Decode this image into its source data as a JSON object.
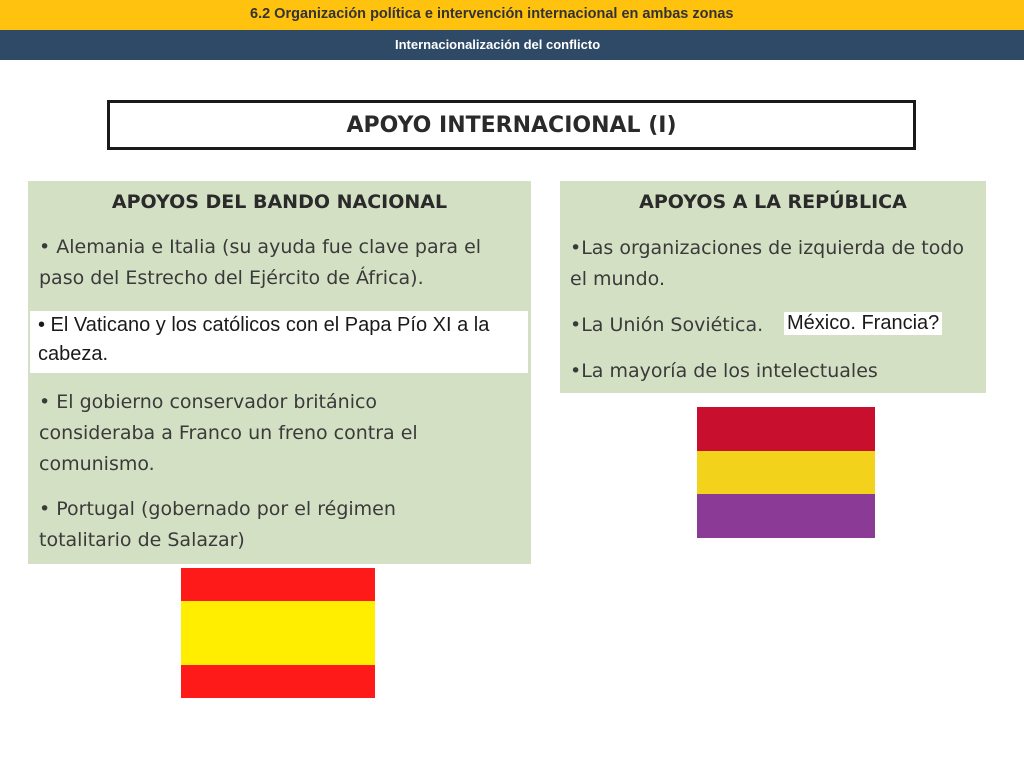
{
  "header": {
    "title": "6.2 Organización política e intervención internacional en ambas zonas",
    "subtitle": "Internacionalización del conflicto"
  },
  "slide": {
    "title": "APOYO INTERNACIONAL (I)"
  },
  "nacional": {
    "heading": "APOYOS DEL BANDO NACIONAL",
    "items": [
      "• Alemania e Italia (su ayuda fue clave para el paso del Estrecho del Ejército de África).",
      "• El Vaticano y los católicos con el Papa Pío XI a la cabeza.",
      "• El gobierno conservador británico consideraba a Franco un freno contra el comunismo.",
      "• Portugal (gobernado por el régimen totalitario de Salazar)"
    ]
  },
  "republica": {
    "heading": "APOYOS A LA REPÚBLICA",
    "items": [
      "•Las organizaciones de izquierda de todo el mundo.",
      "•La Unión Soviética.",
      "•La mayoría de los intelectuales"
    ],
    "added_text": "México. Francia?"
  },
  "colors": {
    "top_bar": "#ffc20e",
    "sub_bar": "#2e4a66",
    "panel": "#d4e0c4",
    "spain_red": "#ff1a1a",
    "spain_yellow": "#ffee00",
    "republic_red": "#c8102e",
    "republic_yellow": "#f2d21a",
    "republic_purple": "#8b3a96"
  }
}
